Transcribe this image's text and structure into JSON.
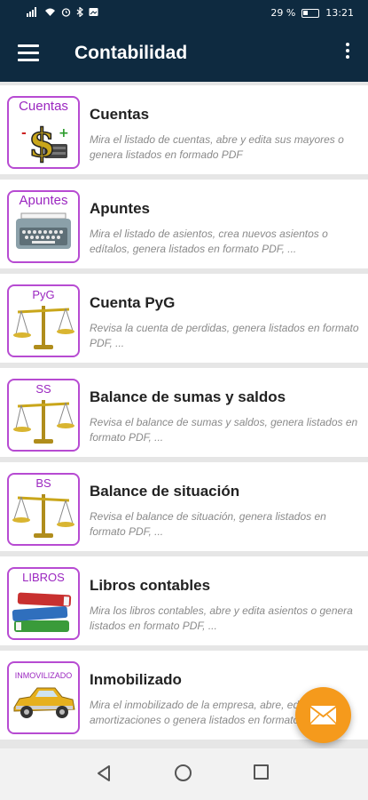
{
  "status_bar": {
    "battery": "29 %",
    "time": "13:21",
    "icons": [
      "signal-icon",
      "wifi-icon",
      "alarm-icon",
      "bluetooth-icon",
      "image-icon"
    ]
  },
  "app_bar": {
    "title": "Contabilidad",
    "menu_icon": "hamburger-menu-icon",
    "overflow_icon": "more-vert-icon"
  },
  "items": [
    {
      "thumb_label": "Cuentas",
      "icon": "dollar-cash-icon",
      "title": "Cuentas",
      "description": "Mira el listado de cuentas, abre y edita sus mayores o genera listados en formado PDF"
    },
    {
      "thumb_label": "Apuntes",
      "icon": "typewriter-icon",
      "title": "Apuntes",
      "description": "Mira el listado de asientos, crea nuevos asientos o edítalos, genera listados en formato PDF, ..."
    },
    {
      "thumb_label": "PyG",
      "icon": "scale-icon",
      "title": "Cuenta PyG",
      "description": "Revisa la cuenta de perdidas, genera listados en formato PDF, ..."
    },
    {
      "thumb_label": "SS",
      "icon": "scale-icon",
      "title": "Balance de sumas y saldos",
      "description": "Revisa el balance de sumas y saldos, genera listados en formato PDF, ..."
    },
    {
      "thumb_label": "BS",
      "icon": "scale-icon",
      "title": "Balance de situación",
      "description": "Revisa el balance de situación, genera listados en formato PDF, ..."
    },
    {
      "thumb_label": "LIBROS",
      "icon": "books-icon",
      "title": "Libros contables",
      "description": "Mira los libros contables, abre y edita asientos o genera listados en formato PDF, ..."
    },
    {
      "thumb_label": "INMOVILIZADO",
      "icon": "car-icon",
      "title": "Inmobilizado",
      "description": "Mira el inmobilizado de la empresa, abre, edita amortizaciones o genera listados en formato PDF, ..."
    }
  ],
  "fab": {
    "icon": "mail-icon",
    "color": "#f59a1c"
  },
  "nav_bar": {
    "icons": [
      "back-icon",
      "home-icon",
      "recent-apps-icon"
    ]
  },
  "colors": {
    "app_bar": "#0e2a40",
    "thumb_border": "#b74bd2",
    "thumb_label": "#9b27c0"
  }
}
